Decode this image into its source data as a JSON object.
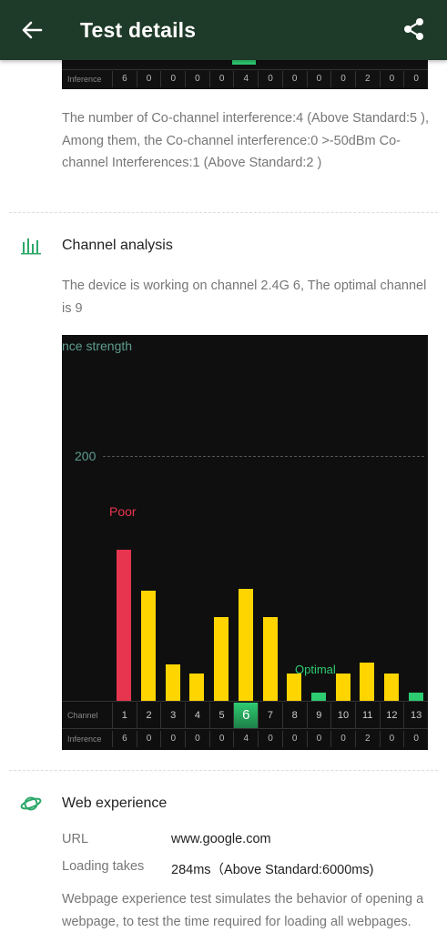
{
  "header": {
    "title": "Test details",
    "back_icon": "arrow-left-icon",
    "share_icon": "share-icon"
  },
  "top_strip": {
    "inference_label": "Inference",
    "inference": [
      "6",
      "0",
      "0",
      "0",
      "0",
      "4",
      "0",
      "0",
      "0",
      "0",
      "2",
      "0",
      "0"
    ]
  },
  "cochannel": {
    "text": "The number of Co-channel interference:4 (Above Standard:5 ), Among them, the Co-channel interference:0 >-50dBm Co-channel Interferences:1 (Above Standard:2 )"
  },
  "channel_analysis": {
    "title": "Channel analysis",
    "icon": "bar-chart-icon",
    "text": "The device is working on channel 2.4G 6, The optimal channel is 9"
  },
  "chart_data": {
    "type": "bar",
    "ylabel": "nce strength",
    "reference_value": "200",
    "poor_label": "Poor",
    "optimal_label": "Optimal",
    "channel_label": "Channel",
    "inference_label": "Inference",
    "categories": [
      "1",
      "2",
      "3",
      "4",
      "5",
      "6",
      "7",
      "8",
      "9",
      "10",
      "11",
      "12",
      "13"
    ],
    "values": [
      158,
      115,
      38,
      29,
      88,
      117,
      88,
      29,
      9,
      29,
      40,
      29,
      9
    ],
    "ylim": [
      0,
      256
    ],
    "colors": [
      "#e8354f",
      "#ffd500",
      "#ffd500",
      "#ffd500",
      "#ffd500",
      "#ffd500",
      "#ffd500",
      "#ffd500",
      "#2ecc71",
      "#ffd500",
      "#ffd500",
      "#ffd500",
      "#2ecc71"
    ],
    "selected_channel": "6",
    "inference": [
      "6",
      "0",
      "0",
      "0",
      "0",
      "4",
      "0",
      "0",
      "0",
      "0",
      "2",
      "0",
      "0"
    ]
  },
  "web_experience": {
    "title": "Web experience",
    "icon": "planet-icon",
    "url_label": "URL",
    "url_value": "www.google.com",
    "loading_label": "Loading takes",
    "loading_value": "284ms（Above Standard:6000ms)",
    "description": "Webpage experience test simulates the behavior of opening a webpage, to test the time required for loading all webpages."
  }
}
